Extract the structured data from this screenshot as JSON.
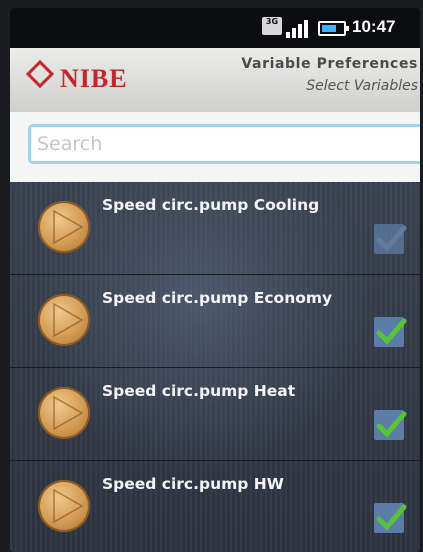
{
  "status_bar": {
    "network_badge": "3G",
    "time": "10:47",
    "icons": [
      "network-3g-icon",
      "signal-bars-icon",
      "battery-icon"
    ]
  },
  "header": {
    "logo": "NIBE",
    "title": "Variable Preferences",
    "subtitle": "Select Variables"
  },
  "search": {
    "placeholder": "Search"
  },
  "variables": [
    {
      "label": "Speed circ.pump Cooling",
      "checked": true,
      "check_style": "dim"
    },
    {
      "label": "Speed circ.pump Economy",
      "checked": true,
      "check_style": "green"
    },
    {
      "label": "Speed circ.pump Heat",
      "checked": true,
      "check_style": "green"
    },
    {
      "label": "Speed circ.pump HW",
      "checked": true,
      "check_style": "green"
    }
  ],
  "colors": {
    "brand_red": "#c2272d",
    "search_border": "#9fd3ef",
    "check_green": "#56c436",
    "checkbox_bg": "#5b7da7"
  }
}
